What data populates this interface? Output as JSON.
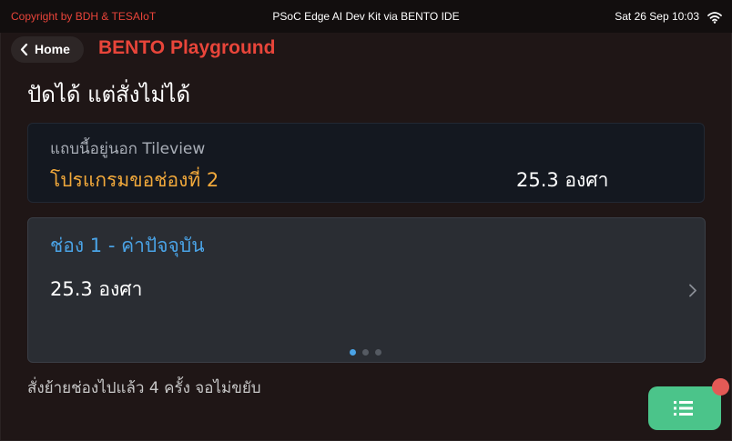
{
  "statusbar": {
    "copyright": "Copyright by BDH & TESAIoT",
    "device_title": "PSoC Edge AI Dev Kit via BENTO IDE",
    "datetime": "Sat 26 Sep 10:03",
    "wifi_icon": "wifi-icon"
  },
  "header": {
    "home_label": "Home",
    "app_title": "BENTO Playground",
    "page_heading": "ปัดได้ แต่สั่งไม่ได้"
  },
  "outside_card": {
    "note": "แถบนี้อยู่นอก Tileview",
    "program_label": "โปรแกรมขอช่องที่ 2",
    "value": "25.3 องศา"
  },
  "tileview": {
    "title": "ช่อง 1 - ค่าปัจจุบัน",
    "value": "25.3 องศา",
    "pages_total": 3,
    "active_page": 1
  },
  "footer": {
    "status_text": "สั่งย้ายช่องไปแล้ว 4 ครั้ง จอไม่ขยับ"
  },
  "fab": {
    "icon": "list-icon",
    "badge_dot": true
  },
  "colors": {
    "background": "#1f1616",
    "statusbar": "#120e0e",
    "accent_red": "#e8453a",
    "program_orange": "#f2a93b",
    "tile_blue": "#4aa3e6",
    "fab_green": "#4bc48a",
    "badge_red": "#e35a56"
  }
}
